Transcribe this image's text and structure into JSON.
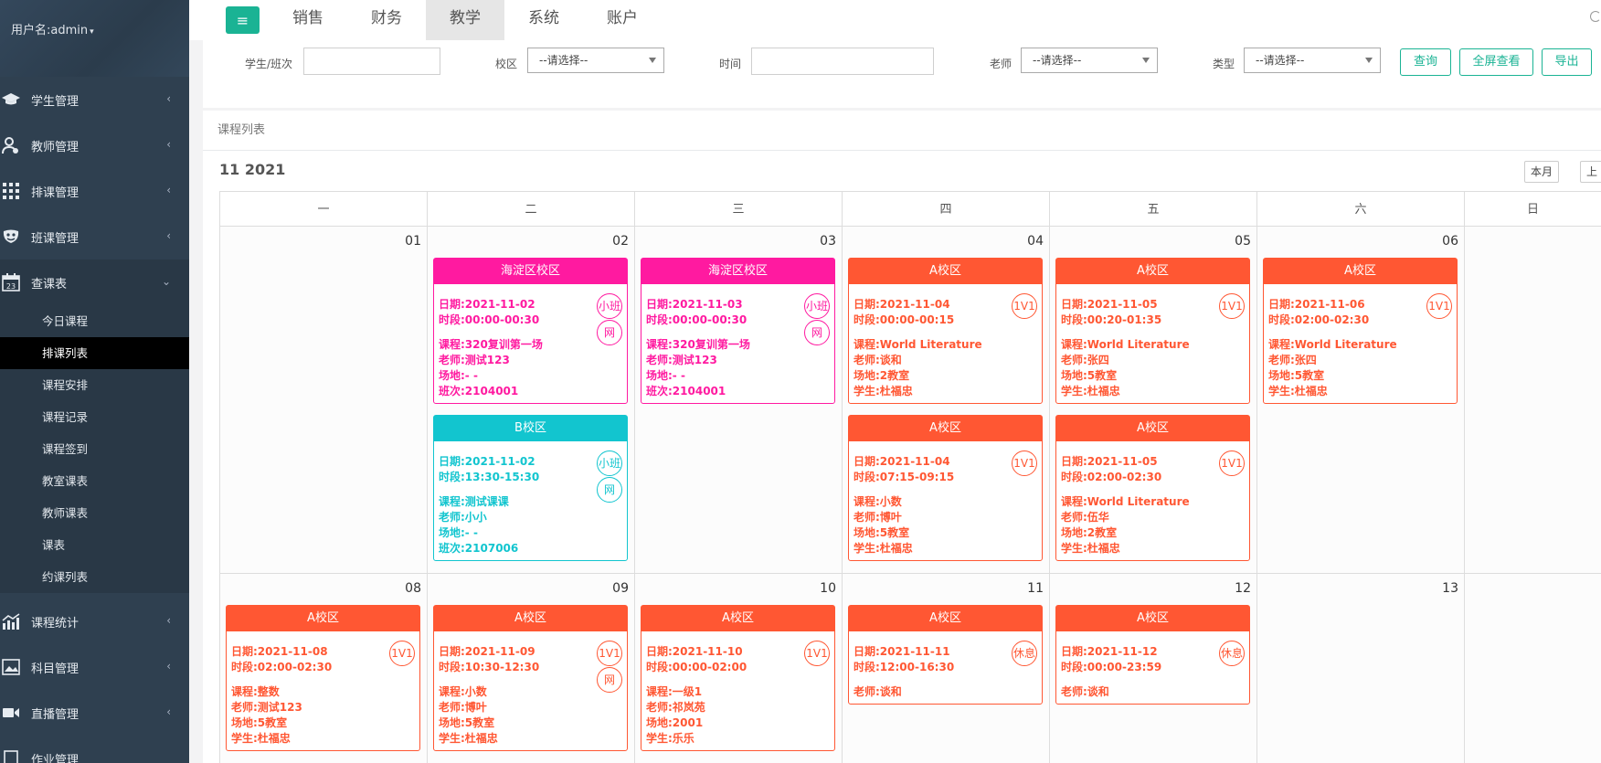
{
  "sidebar": {
    "username": "用户名:admin",
    "items": [
      {
        "label": "学生管理",
        "icon": "graduation-cap-icon"
      },
      {
        "label": "教师管理",
        "icon": "teacher-icon"
      },
      {
        "label": "排课管理",
        "icon": "grid-icon"
      },
      {
        "label": "班课管理",
        "icon": "mask-icon"
      },
      {
        "label": "查课表",
        "icon": "calendar-icon"
      },
      {
        "label": "课程统计",
        "icon": "chart-icon"
      },
      {
        "label": "科目管理",
        "icon": "image-icon"
      },
      {
        "label": "直播管理",
        "icon": "video-icon"
      },
      {
        "label": "作业管理",
        "icon": "homework-icon"
      }
    ],
    "sub_items": [
      "今日课程",
      "排课列表",
      "课程安排",
      "课程记录",
      "课程签到",
      "教室课表",
      "教师课表",
      "课表",
      "约课列表"
    ]
  },
  "topbar": {
    "tabs": [
      "销售",
      "财务",
      "教学",
      "系统",
      "账户"
    ],
    "active_tab": "教学"
  },
  "filters": {
    "student_label": "学生/班次",
    "campus_label": "校区",
    "campus_value": "--请选择--",
    "time_label": "时间",
    "teacher_label": "老师",
    "teacher_value": "--请选择--",
    "type_label": "类型",
    "type_value": "--请选择--",
    "query_btn": "查询",
    "fullscreen_btn": "全屏查看",
    "export_btn": "导出"
  },
  "panel": {
    "title": "课程列表",
    "month_title": "11 2021",
    "this_month_btn": "本月",
    "prev_btn": "上"
  },
  "calendar": {
    "weekdays": [
      "一",
      "二",
      "三",
      "四",
      "五",
      "六",
      "日"
    ],
    "week1_days": [
      "01",
      "02",
      "03",
      "04",
      "05",
      "06",
      ""
    ],
    "week2_days": [
      "08",
      "09",
      "10",
      "11",
      "12",
      "13",
      ""
    ],
    "events": [
      {
        "header": "海淀区校区",
        "date": "日期:2021-11-02",
        "time": "时段:00:00-00:30",
        "course": "课程:320复训第一场",
        "teacher": "老师:测试123",
        "venue": "场地:- -",
        "extra": "班次:2104001",
        "badges": [
          "小班",
          "网"
        ],
        "color": "pink"
      },
      {
        "header": "B校区",
        "date": "日期:2021-11-02",
        "time": "时段:13:30-15:30",
        "course": "课程:测试课课",
        "teacher": "老师:小小",
        "venue": "场地:- -",
        "extra": "班次:2107006",
        "badges": [
          "小班",
          "网"
        ],
        "color": "teal"
      },
      {
        "header": "海淀区校区",
        "date": "日期:2021-11-03",
        "time": "时段:00:00-00:30",
        "course": "课程:320复训第一场",
        "teacher": "老师:测试123",
        "venue": "场地:- -",
        "extra": "班次:2104001",
        "badges": [
          "小班",
          "网"
        ],
        "color": "pink"
      },
      {
        "header": "A校区",
        "date": "日期:2021-11-04",
        "time": "时段:00:00-00:15",
        "course": "课程:World Literature",
        "teacher": "老师:谈和",
        "venue": "场地:2教室",
        "extra": "学生:杜福忠",
        "badges": [
          "1V1"
        ],
        "color": "orange"
      },
      {
        "header": "A校区",
        "date": "日期:2021-11-04",
        "time": "时段:07:15-09:15",
        "course": "课程:小数",
        "teacher": "老师:博叶",
        "venue": "场地:5教室",
        "extra": "学生:杜福忠",
        "badges": [
          "1V1"
        ],
        "color": "orange"
      },
      {
        "header": "A校区",
        "date": "日期:2021-11-05",
        "time": "时段:00:20-01:35",
        "course": "课程:World Literature",
        "teacher": "老师:张四",
        "venue": "场地:5教室",
        "extra": "学生:杜福忠",
        "badges": [
          "1V1"
        ],
        "color": "orange"
      },
      {
        "header": "A校区",
        "date": "日期:2021-11-05",
        "time": "时段:02:00-02:30",
        "course": "课程:World Literature",
        "teacher": "老师:伍华",
        "venue": "场地:2教室",
        "extra": "学生:杜福忠",
        "badges": [
          "1V1"
        ],
        "color": "orange"
      },
      {
        "header": "A校区",
        "date": "日期:2021-11-06",
        "time": "时段:02:00-02:30",
        "course": "课程:World Literature",
        "teacher": "老师:张四",
        "venue": "场地:5教室",
        "extra": "学生:杜福忠",
        "badges": [
          "1V1"
        ],
        "color": "orange"
      },
      {
        "header": "A校区",
        "date": "日期:2021-11-08",
        "time": "时段:02:00-02:30",
        "course": "课程:整数",
        "teacher": "老师:测试123",
        "venue": "场地:5教室",
        "extra": "学生:杜福忠",
        "badges": [
          "1V1"
        ],
        "color": "orange"
      },
      {
        "header": "A校区",
        "date": "日期:2021-11-09",
        "time": "时段:10:30-12:30",
        "course": "课程:小数",
        "teacher": "老师:博叶",
        "venue": "场地:5教室",
        "extra": "学生:杜福忠",
        "badges": [
          "1V1",
          "网"
        ],
        "color": "orange"
      },
      {
        "header": "A校区",
        "date": "日期:2021-11-10",
        "time": "时段:00:00-02:00",
        "course": "课程:一级1",
        "teacher": "老师:祁岚苑",
        "venue": "场地:2001",
        "extra": "学生:乐乐",
        "badges": [
          "1V1"
        ],
        "color": "orange"
      },
      {
        "header": "A校区",
        "date": "日期:2021-11-11",
        "time": "时段:12:00-16:30",
        "teacher": "老师:谈和",
        "badges": [
          "休息"
        ],
        "color": "orange"
      },
      {
        "header": "A校区",
        "date": "日期:2021-11-12",
        "time": "时段:00:00-23:59",
        "teacher": "老师:谈和",
        "badges": [
          "休息"
        ],
        "color": "orange"
      }
    ]
  }
}
